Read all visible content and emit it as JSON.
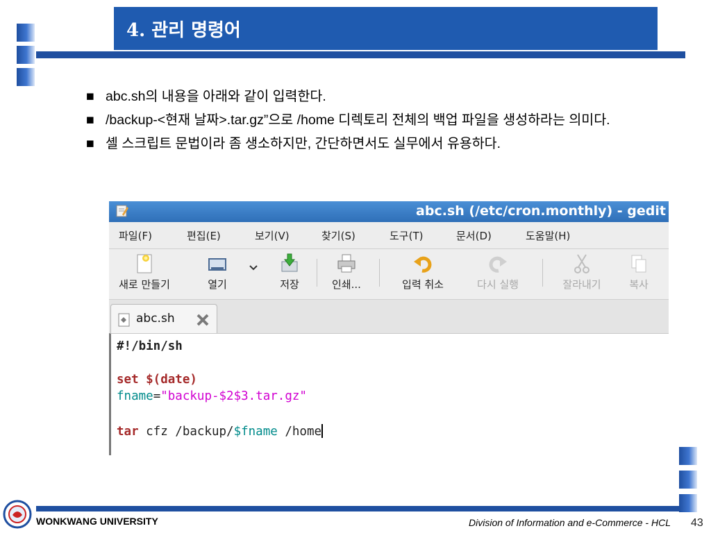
{
  "slide": {
    "title": "4. 관리 명령어",
    "bullets": [
      "abc.sh의 내용을 아래와 같이 입력한다.",
      "/backup-<현재 날짜>.tar.gz”으로 /home 디렉토리 전체의 백업 파일을 생성하라는 의미다.",
      "셸 스크립트 문법이라 좀 생소하지만, 간단하면서도 실무에서 유용하다."
    ],
    "bullet_marker": "■"
  },
  "gedit": {
    "title": "abc.sh (/etc/cron.monthly) - gedit",
    "menu": [
      "파일(F)",
      "편집(E)",
      "보기(V)",
      "찾기(S)",
      "도구(T)",
      "문서(D)",
      "도움말(H)"
    ],
    "toolbar": {
      "new": "새로 만들기",
      "open": "열기",
      "save": "저장",
      "print": "인쇄...",
      "undo": "입력 취소",
      "redo": "다시 실행",
      "cut": "잘라내기",
      "copy": "복사"
    },
    "tab_label": "abc.sh",
    "code": {
      "line1": "#!/bin/sh",
      "line2_kw": "set",
      "line2_rest": " $(date)",
      "line3_var": "fname",
      "line3_eq": "=",
      "line3_str": "\"backup-$2$3.tar.gz\"",
      "line4_kw": "tar",
      "line4_a": " cfz /backup/",
      "line4_var": "$fname",
      "line4_b": " /home"
    }
  },
  "footer": {
    "university": "WONKWANG UNIVERSITY",
    "division": "Division of Information and e-Commerce - HCL",
    "page": "43"
  },
  "colors": {
    "title_band": "#1f5bb0",
    "rule": "#1f4fa0",
    "keyword": "#a52a2a",
    "variable": "#008b8b",
    "string": "#d100d1"
  }
}
